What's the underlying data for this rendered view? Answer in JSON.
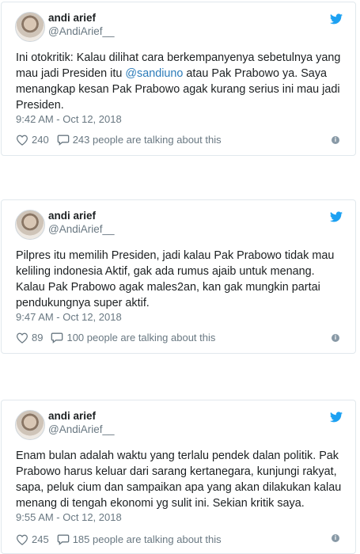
{
  "tweets": [
    {
      "name": "andi arief",
      "handle": "@AndiArief__",
      "text_before": "Ini otokritik: Kalau dilihat cara berkempanyenya sebetulnya yang mau jadi Presiden itu ",
      "mention": "@sandiuno",
      "text_after": " atau Pak Prabowo ya. Saya menangkap kesan Pak Prabowo agak kurang serius ini mau jadi Presiden.",
      "timestamp": "9:42 AM - Oct 12, 2018",
      "likes": "240",
      "talking": "243 people are talking about this"
    },
    {
      "name": "andi arief",
      "handle": "@AndiArief__",
      "text_before": "Pilpres itu memilih Presiden, jadi kalau Pak Prabowo tidak mau keliling indonesia Aktif, gak ada rumus ajaib untuk menang. Kalau Pak Prabowo agak males2an, kan gak mungkin partai pendukungnya super aktif.",
      "mention": "",
      "text_after": "",
      "timestamp": "9:47 AM - Oct 12, 2018",
      "likes": "89",
      "talking": "100 people are talking about this"
    },
    {
      "name": "andi arief",
      "handle": "@AndiArief__",
      "text_before": "Enam bulan adalah waktu yang terlalu pendek dalan politik. Pak Prabowo harus keluar dari sarang kertanegara, kunjungi rakyat, sapa, peluk cium dan sampaikan apa yang akan dilakukan kalau menang di tengah ekonomi yg sulit ini. Sekian kritik saya.",
      "mention": "",
      "text_after": "",
      "timestamp": "9:55 AM - Oct 12, 2018",
      "likes": "245",
      "talking": "185 people are talking about this"
    }
  ],
  "colors": {
    "twitter_blue": "#1da1f2",
    "meta_gray": "#697882",
    "border": "#e1e8ed",
    "link": "#2b7bb9"
  },
  "icons": {
    "brand": "twitter-bird-icon",
    "like": "heart-icon",
    "reply": "speech-bubble-icon",
    "info": "info-icon"
  }
}
